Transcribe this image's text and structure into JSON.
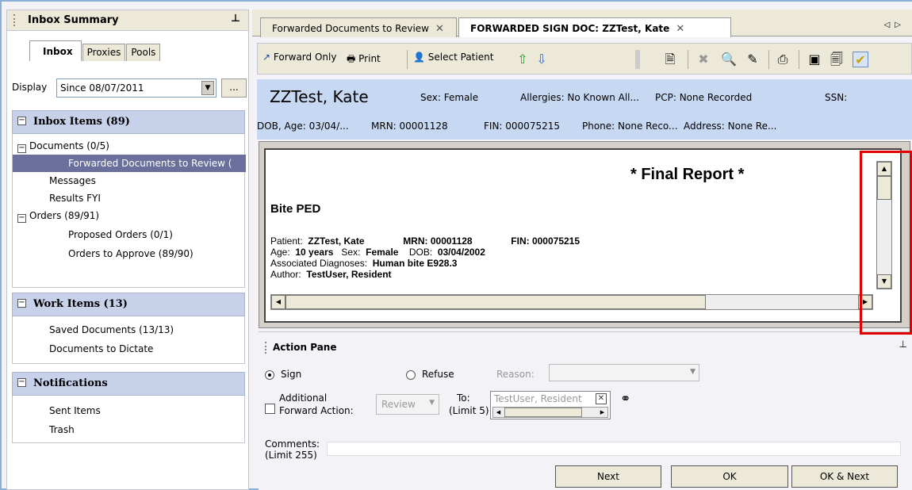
{
  "left_panel": {
    "title": "Inbox Summary",
    "pin": "⊥",
    "tabs": [
      "Inbox",
      "Proxies",
      "Pools"
    ],
    "display_label": "Display",
    "display_value": "Since 08/07/2011",
    "display_more": "...",
    "inbox_items": {
      "header": "Inbox Items (89)",
      "documents": "Documents (0/5)",
      "forwarded": "Forwarded Documents to Review (",
      "messages": "Messages",
      "results_fyi": "Results FYI",
      "orders": "Orders (89/91)",
      "proposed": "Proposed Orders (0/1)",
      "to_approve": "Orders to Approve (89/90)"
    },
    "work_items": {
      "header": "Work Items (13)",
      "saved": "Saved Documents (13/13)",
      "dictate": "Documents to Dictate"
    },
    "notifications": {
      "header": "Notifications",
      "sent": "Sent Items",
      "trash": "Trash"
    }
  },
  "tabs": {
    "tab1": "Forwarded Documents to Review",
    "tab2": "FORWARDED SIGN DOC: ZZTest, Kate"
  },
  "toolbar": {
    "forward_only": "Forward Only",
    "print": "Print",
    "select_patient": "Select Patient"
  },
  "banner": {
    "name": "ZZTest, Kate",
    "sex": "Sex: Female",
    "allergies": "Allergies: No Known All...",
    "pcp": "PCP: None Recorded",
    "ssn": "SSN:",
    "dob": "DOB, Age: 03/04/...",
    "mrn": "MRN: 00001128",
    "fin": "FIN: 000075215",
    "phone": "Phone: None Reco...",
    "address": "Address: None Re..."
  },
  "document": {
    "final_report": "* Final Report *",
    "title": "Bite PED",
    "patient_label": "Patient:",
    "patient_value": "ZZTest, Kate",
    "mrn_label": "MRN:",
    "mrn_value": "00001128",
    "fin_label": "FIN:",
    "fin_value": "000075215",
    "age_label": "Age:",
    "age_value": "10 years",
    "sex_label": "Sex:",
    "sex_value": "Female",
    "dob_label": "DOB:",
    "dob_value": "03/04/2002",
    "diag_label": "Associated Diagnoses:",
    "diag_value": "Human bite E928.3",
    "author_label": "Author:",
    "author_value": "TestUser, Resident"
  },
  "action_pane": {
    "title": "Action Pane",
    "sign": "Sign",
    "refuse": "Refuse",
    "reason": "Reason:",
    "additional_1": "Additional",
    "additional_2": "Forward Action:",
    "review": "Review",
    "to_1": "To:",
    "to_2": "(Limit 5)",
    "to_value": "TestUser, Resident",
    "comments_1": "Comments:",
    "comments_2": "(Limit 255)",
    "next": "Next",
    "ok": "OK",
    "ok_next": "OK & Next"
  }
}
